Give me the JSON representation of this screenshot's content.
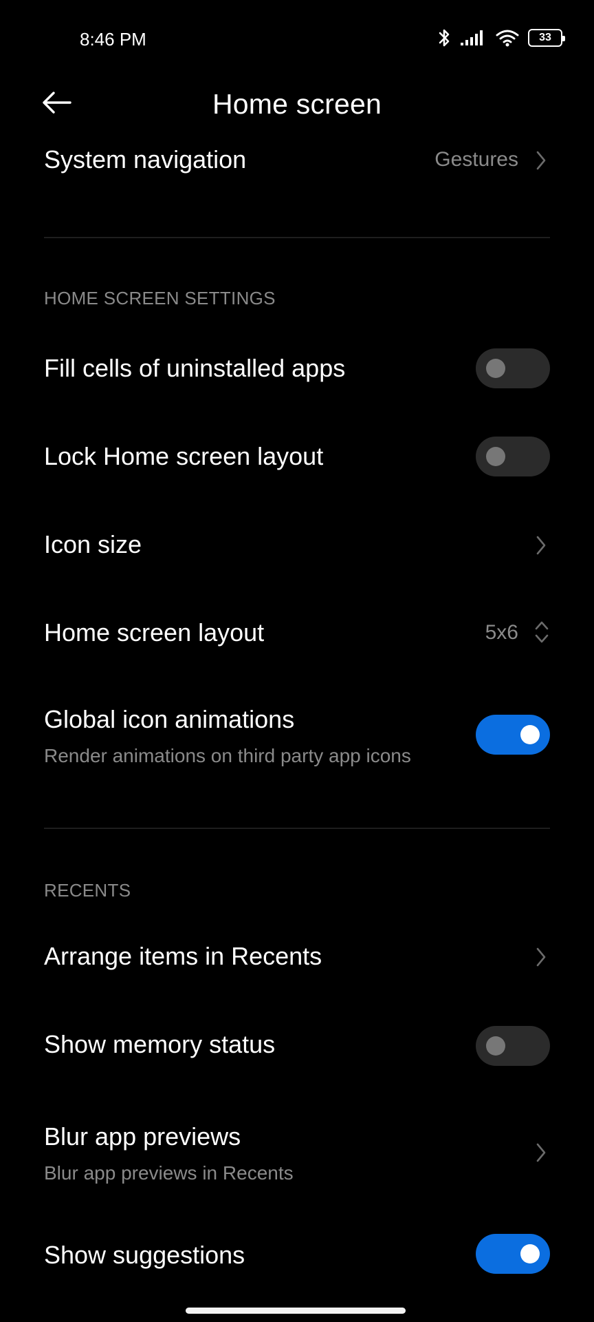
{
  "status_bar": {
    "time": "8:46 PM",
    "battery": "33",
    "icons": [
      "bluetooth-icon",
      "signal-icon",
      "wifi-icon",
      "battery-icon"
    ]
  },
  "header": {
    "title": "Home screen",
    "back_icon": "arrow-left-icon"
  },
  "system_navigation": {
    "title": "System navigation",
    "value": "Gestures"
  },
  "home_screen_settings": {
    "header": "HOME SCREEN SETTINGS",
    "fill_cells": {
      "title": "Fill cells of uninstalled apps",
      "enabled": false
    },
    "lock_layout": {
      "title": "Lock Home screen layout",
      "enabled": false
    },
    "icon_size": {
      "title": "Icon size"
    },
    "home_layout": {
      "title": "Home screen layout",
      "value": "5x6"
    },
    "global_icon_animations": {
      "title": "Global icon animations",
      "subtitle": "Render animations on third party app icons",
      "enabled": true
    }
  },
  "recents": {
    "header": "RECENTS",
    "arrange_items": {
      "title": "Arrange items in Recents"
    },
    "memory_status": {
      "title": "Show memory status",
      "enabled": false
    },
    "blur_previews": {
      "title": "Blur app previews",
      "subtitle": "Blur app previews in Recents"
    },
    "show_suggestions": {
      "title": "Show suggestions",
      "enabled": true
    }
  },
  "colors": {
    "background": "#000000",
    "accent_toggle_on": "#0b6ee0",
    "toggle_off": "#2b2b2b",
    "secondary_text": "#8a8a8a"
  }
}
